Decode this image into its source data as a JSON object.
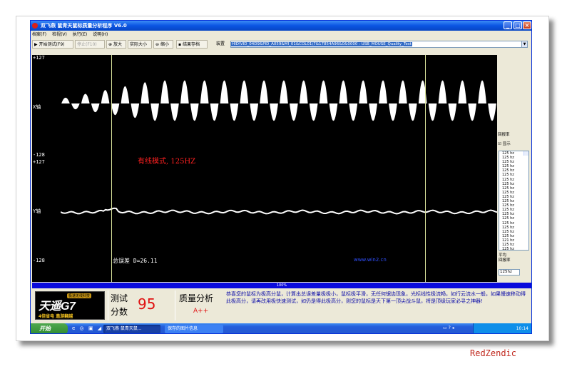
{
  "window": {
    "title": "双飞燕 鼠青天鼠标质量分析程序 V6.0",
    "buttons": [
      "_",
      "□",
      "×"
    ]
  },
  "menu": [
    "档案(F)",
    "检视(V)",
    "执行(E)",
    "说明(H)"
  ],
  "toolbar": {
    "start": "▶ 开始测试(F9)",
    "stop": "停止(F10)",
    "zoom_in": "放大",
    "actual_size": "实际大小",
    "zoom_out": "缩小",
    "save": "结果存档",
    "device_label": "装置",
    "device_value": "HID\\VID_04D9&PID_A059&MI_01&COL01\\7&17854A96&0&0000 : USB_MOUSE_Quality_Test"
  },
  "scope": {
    "x_top": "+127",
    "x_axis": "X轴",
    "x_bottom": "-128",
    "y_top": "+127",
    "y_axis": "Y轴",
    "y_bottom": "-128",
    "mode": "有线模式, 125HZ",
    "error": "总误差 D=26.11",
    "site": "www.win2.cn"
  },
  "rate_panel": {
    "title": "回报率",
    "show_label": "显示",
    "values": [
      "125 hz",
      "125 hz",
      "125 hz",
      "125 hz",
      "125 hz",
      "125 hz",
      "125 hz",
      "125 hz",
      "125 hz",
      "125 hz",
      "125 hz",
      "125 hz",
      "125 hz",
      "125 hz",
      "125 hz",
      "125 hz",
      "125 hz",
      "125 hz",
      "125 hz",
      "125 hz",
      "121 hz",
      "125 hz",
      "125 hz"
    ],
    "avg_label_1": "平均",
    "avg_label_2": "回报率",
    "avg_value": "125hz"
  },
  "progress": "100%",
  "bottom": {
    "logo_main": "天遥G7",
    "logo_badge": "极速无线科技",
    "logo_sub": "4倍省电 遨游翻越",
    "score_label": "测试分数",
    "score_value": "95",
    "quality_title": "质量分析",
    "quality_grade": "A++",
    "quality_desc": "恭喜您的鼠标为极高分鼠，计算出总误差量极极小，鼠标极平滑，无任何锯齿现象，光标线性极流畅，如行云流水一般，如果慢速移动得此极高分，请再改用极快速测试，如仍是得此极高分，则您的鼠标是天下第一顶尖战斗鼠，将是顶级玩家必寻之神器!"
  },
  "taskbar": {
    "start": "开始",
    "quicklaunch": "e ◎ ▣ ◢",
    "task1": "双飞燕 鼠青天鼠...",
    "task2": "保存的图片信息",
    "lang": "▭ ? ◂",
    "time": "10:14"
  },
  "signature": "RedZendic"
}
